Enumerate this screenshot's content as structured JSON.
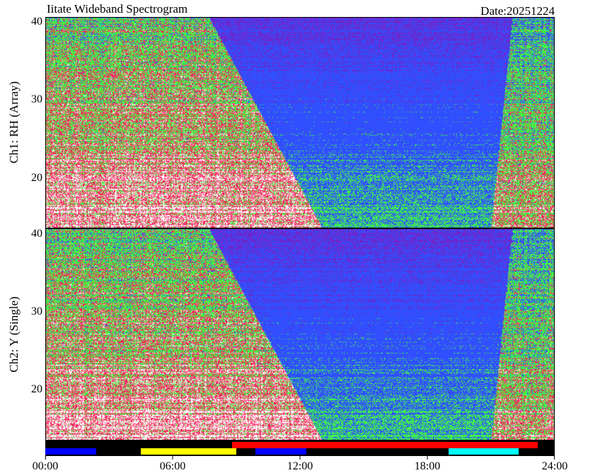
{
  "header": {
    "title": "Iitate Wideband Spectrogram",
    "date": "Date:20251224"
  },
  "chart_data": [
    {
      "type": "heatmap",
      "name": "Ch1",
      "ylabel": "Ch1: RH (Array)",
      "ylim": [
        12,
        40.5
      ],
      "yticks": [
        20,
        30,
        40
      ],
      "xlim": [
        "00:00",
        "24:00"
      ],
      "day_quiet_start_hours": 9.3,
      "day_quiet_end_hours": 21.8
    },
    {
      "type": "heatmap",
      "name": "Ch2",
      "ylabel": "Ch2: Y (Single)",
      "ylim": [
        12,
        40.5
      ],
      "yticks": [
        20,
        30,
        40
      ],
      "xlim": [
        "00:00",
        "24:00"
      ],
      "day_quiet_start_hours": 9.3,
      "day_quiet_end_hours": 21.8
    }
  ],
  "x_axis": {
    "ticks": [
      "00:00",
      "06:00",
      "12:00",
      "18:00",
      "24:00"
    ]
  },
  "status_bar": {
    "background": "#000000",
    "upper_segments": [
      {
        "start_hours": 8.8,
        "end_hours": 23.2,
        "color": "#ff0000"
      }
    ],
    "lower_segments": [
      {
        "start_hours": 0.0,
        "end_hours": 2.4,
        "color": "#0000ff"
      },
      {
        "start_hours": 4.5,
        "end_hours": 9.0,
        "color": "#ffff00"
      },
      {
        "start_hours": 9.9,
        "end_hours": 12.3,
        "color": "#0000ff"
      },
      {
        "start_hours": 19.0,
        "end_hours": 22.3,
        "color": "#00ffff"
      }
    ]
  },
  "colors": {
    "noise_high": "#ffffff",
    "noise_mid": "#ff2060",
    "noise_low": "#40ff40",
    "quiet_low": "#3050ff",
    "quiet_high": "#7a1fc4"
  }
}
